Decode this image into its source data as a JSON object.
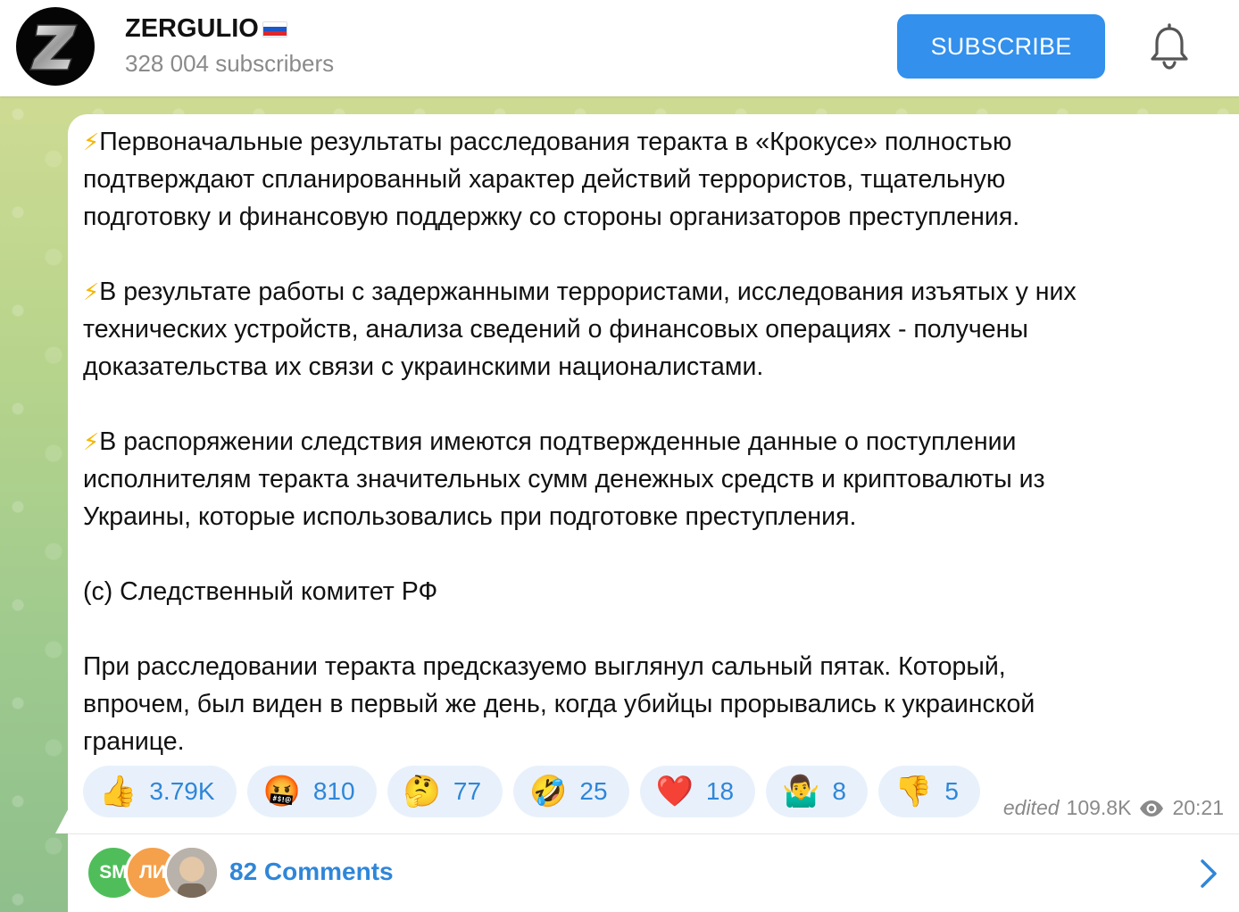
{
  "channel": {
    "name": "ZERGULIO",
    "subscribers": "328 004 subscribers",
    "subscribe_label": "SUBSCRIBE",
    "accent": "#3390ec"
  },
  "message": {
    "paragraphs": [
      {
        "bolt": "⚡",
        "text": "Первоначальные результаты расследования теракта в «Крокусе» полностью\nподтверждают спланированный характер действий террористов, тщательную\nподготовку и финансовую поддержку со стороны организаторов преступления."
      },
      {
        "bolt": "⚡",
        "text": "В результате работы с задержанными террористами, исследования изъятых у них\nтехнических устройств, анализа сведений о финансовых операциях - получены\nдоказательства их связи с украинскими националистами."
      },
      {
        "bolt": "⚡",
        "text": "В распоряжении следствия имеются подтвержденные данные о поступлении\nисполнителям теракта значительных сумм денежных средств и криптовалюты из\nУкраины, которые использовались при подготовке преступления."
      },
      {
        "bolt": "",
        "text": "(с) Следственный комитет РФ"
      },
      {
        "bolt": "",
        "text": "При расследовании теракта предсказуемо выглянул сальный пятак. Который,\nвпрочем, был виден в первый же день, когда убийцы прорывались к украинской\nгранице."
      }
    ]
  },
  "reactions": [
    {
      "emoji": "👍",
      "count": "3.79K",
      "icon": "thumbs-up-icon"
    },
    {
      "emoji": "🤬",
      "count": "810",
      "icon": "cursing-face-icon"
    },
    {
      "emoji": "🤔",
      "count": "77",
      "icon": "thinking-face-icon"
    },
    {
      "emoji": "🤣",
      "count": "25",
      "icon": "rofl-face-icon"
    },
    {
      "emoji": "❤️",
      "count": "18",
      "icon": "heart-icon"
    },
    {
      "emoji": "🤷‍♂️",
      "count": "8",
      "icon": "shrug-icon"
    },
    {
      "emoji": "👎",
      "count": "5",
      "icon": "thumbs-down-icon"
    }
  ],
  "meta": {
    "edited": "edited",
    "views": "109.8K",
    "time": "20:21"
  },
  "comments": {
    "label": "82 Comments",
    "avatars": [
      {
        "initials": "SM",
        "color": "#4fbe5a"
      },
      {
        "initials": "ЛИ",
        "color": "#f5a04a"
      },
      {
        "initials": "",
        "color": "#c8a88a"
      }
    ]
  }
}
